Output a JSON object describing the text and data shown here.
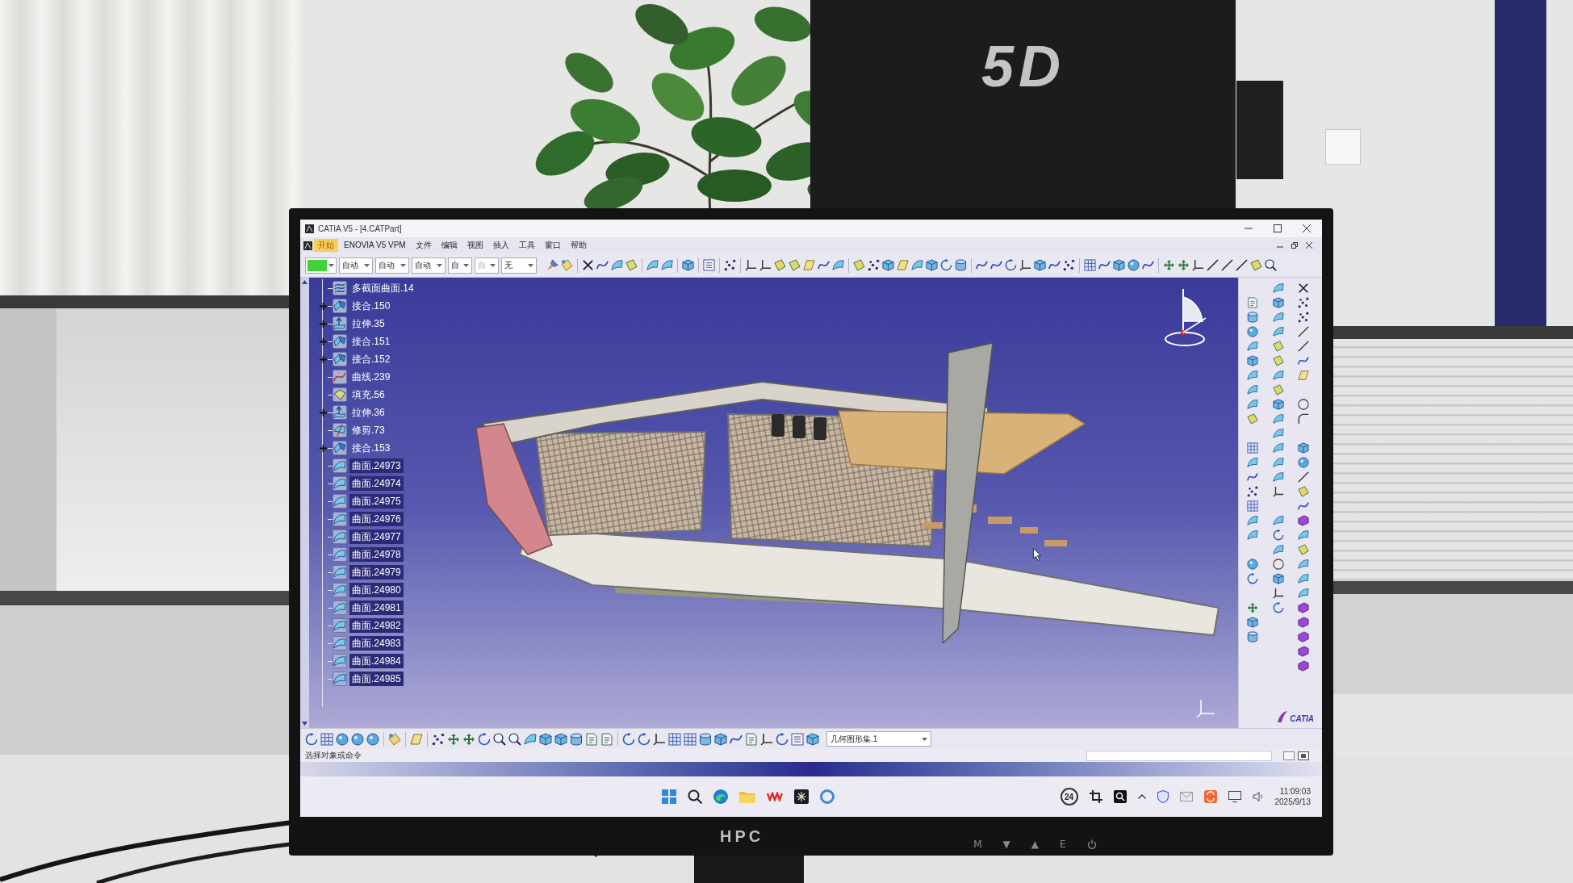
{
  "scene": {
    "wall_logo": "5D"
  },
  "window": {
    "title": "CATIA V5 - [4.CATPart]"
  },
  "menu": [
    {
      "label": "开始",
      "selected": true
    },
    {
      "label": "ENOVIA V5 VPM",
      "selected": false
    },
    {
      "label": "文件",
      "selected": false
    },
    {
      "label": "编辑",
      "selected": false
    },
    {
      "label": "视图",
      "selected": false
    },
    {
      "label": "插入",
      "selected": false
    },
    {
      "label": "工具",
      "selected": false
    },
    {
      "label": "窗口",
      "selected": false
    },
    {
      "label": "帮助",
      "selected": false
    }
  ],
  "toolbar": {
    "dropdowns": [
      {
        "value": "自动",
        "disabled": false
      },
      {
        "value": "自动",
        "disabled": false
      },
      {
        "value": "自动",
        "disabled": false
      },
      {
        "value": "自",
        "disabled": false
      },
      {
        "value": "自",
        "disabled": true
      },
      {
        "value": "无",
        "disabled": false
      }
    ]
  },
  "tree": {
    "items": [
      {
        "label": "多截面曲面.14",
        "kind": "loft",
        "expandable": false,
        "selected": false
      },
      {
        "label": "接合.150",
        "kind": "join",
        "expandable": true,
        "selected": false
      },
      {
        "label": "拉伸.35",
        "kind": "extrude",
        "expandable": true,
        "selected": false
      },
      {
        "label": "接合.151",
        "kind": "join",
        "expandable": true,
        "selected": false
      },
      {
        "label": "接合.152",
        "kind": "join",
        "expandable": true,
        "selected": false
      },
      {
        "label": "曲线.239",
        "kind": "curve",
        "expandable": false,
        "selected": false
      },
      {
        "label": "填充.56",
        "kind": "fill",
        "expandable": false,
        "selected": false
      },
      {
        "label": "拉伸.36",
        "kind": "extrude",
        "expandable": true,
        "selected": false
      },
      {
        "label": "修剪.73",
        "kind": "trim",
        "expandable": false,
        "selected": false
      },
      {
        "label": "接合.153",
        "kind": "join",
        "expandable": true,
        "selected": false
      },
      {
        "label": "曲面.24973",
        "kind": "surface",
        "expandable": false,
        "selected": true
      },
      {
        "label": "曲面.24974",
        "kind": "surface",
        "expandable": false,
        "selected": true
      },
      {
        "label": "曲面.24975",
        "kind": "surface",
        "expandable": false,
        "selected": true
      },
      {
        "label": "曲面.24976",
        "kind": "surface",
        "expandable": false,
        "selected": true
      },
      {
        "label": "曲面.24977",
        "kind": "surface",
        "expandable": false,
        "selected": true
      },
      {
        "label": "曲面.24978",
        "kind": "surface",
        "expandable": false,
        "selected": true
      },
      {
        "label": "曲面.24979",
        "kind": "surface",
        "expandable": false,
        "selected": true
      },
      {
        "label": "曲面.24980",
        "kind": "surface",
        "expandable": false,
        "selected": true
      },
      {
        "label": "曲面.24981",
        "kind": "surface",
        "expandable": false,
        "selected": true
      },
      {
        "label": "曲面.24982",
        "kind": "surface",
        "expandable": false,
        "selected": true
      },
      {
        "label": "曲面.24983",
        "kind": "surface",
        "expandable": false,
        "selected": true
      },
      {
        "label": "曲面.24984",
        "kind": "surface",
        "expandable": false,
        "selected": true
      },
      {
        "label": "曲面.24985",
        "kind": "surface",
        "expandable": false,
        "selected": true
      }
    ]
  },
  "bottom_toolbar": {
    "dropdown": "几何图形集.1"
  },
  "status_bar": {
    "text": "选择对象或命令"
  },
  "logo": {
    "text": "CATIA"
  },
  "taskbar": {
    "badge": "24",
    "time": "11:09:03",
    "date": "2025/9/13"
  },
  "monitor": {
    "brand": "HPC",
    "buttons": [
      "M",
      "▼",
      "▲",
      "E"
    ]
  }
}
